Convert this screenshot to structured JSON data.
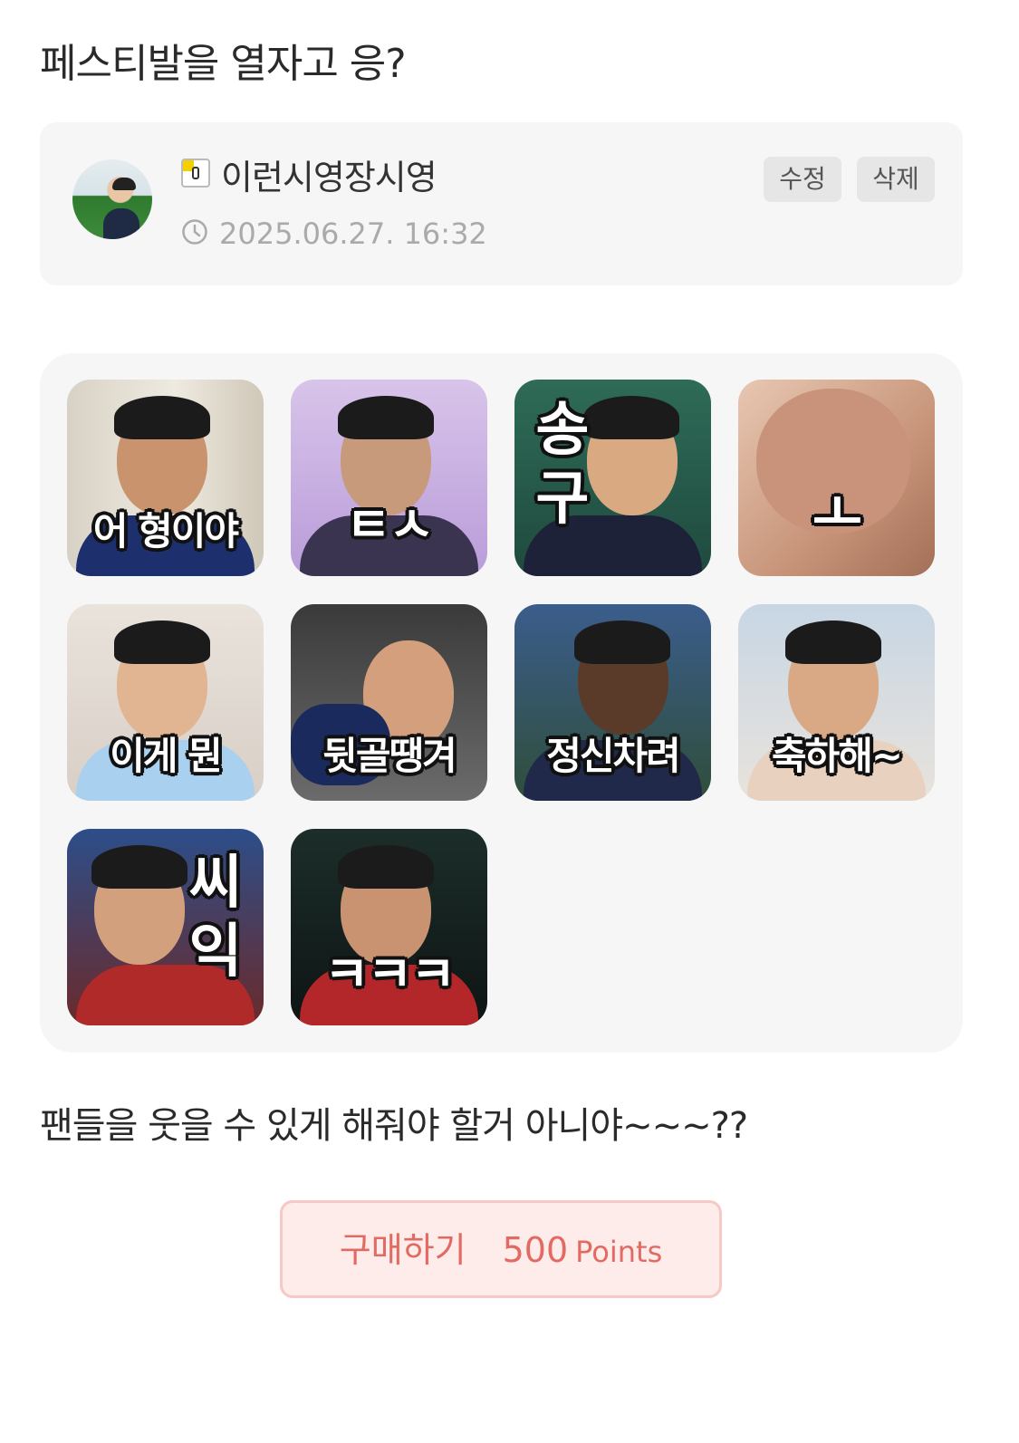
{
  "post": {
    "title": "페스티발을 열자고 응?",
    "description": "팬들을 웃을 수 있게 해줘야 할거 아니야~~~??"
  },
  "author": {
    "name": "이런시영장시영",
    "date": "2025.06.27. 16:32",
    "level_icon": "level-badge-icon",
    "avatar": "user-avatar"
  },
  "actions": {
    "edit_label": "수정",
    "delete_label": "삭제"
  },
  "emoticons": [
    {
      "caption": "어 형이야"
    },
    {
      "caption": "ㅌㅅ"
    },
    {
      "caption": "송구"
    },
    {
      "caption": "ㅗ"
    },
    {
      "caption": "이게 뭔"
    },
    {
      "caption": "뒷골땡겨"
    },
    {
      "caption": "정신차려"
    },
    {
      "caption": "축하해~"
    },
    {
      "caption": "씨익"
    },
    {
      "caption": "ㅋㅋㅋ"
    }
  ],
  "purchase": {
    "label": "구매하기",
    "points": "500",
    "unit": "Points"
  },
  "colors": {
    "panel_bg": "#f6f6f6",
    "buy_bg": "#fdecea",
    "buy_border": "#f6c9c5",
    "buy_text": "#e26a62"
  }
}
